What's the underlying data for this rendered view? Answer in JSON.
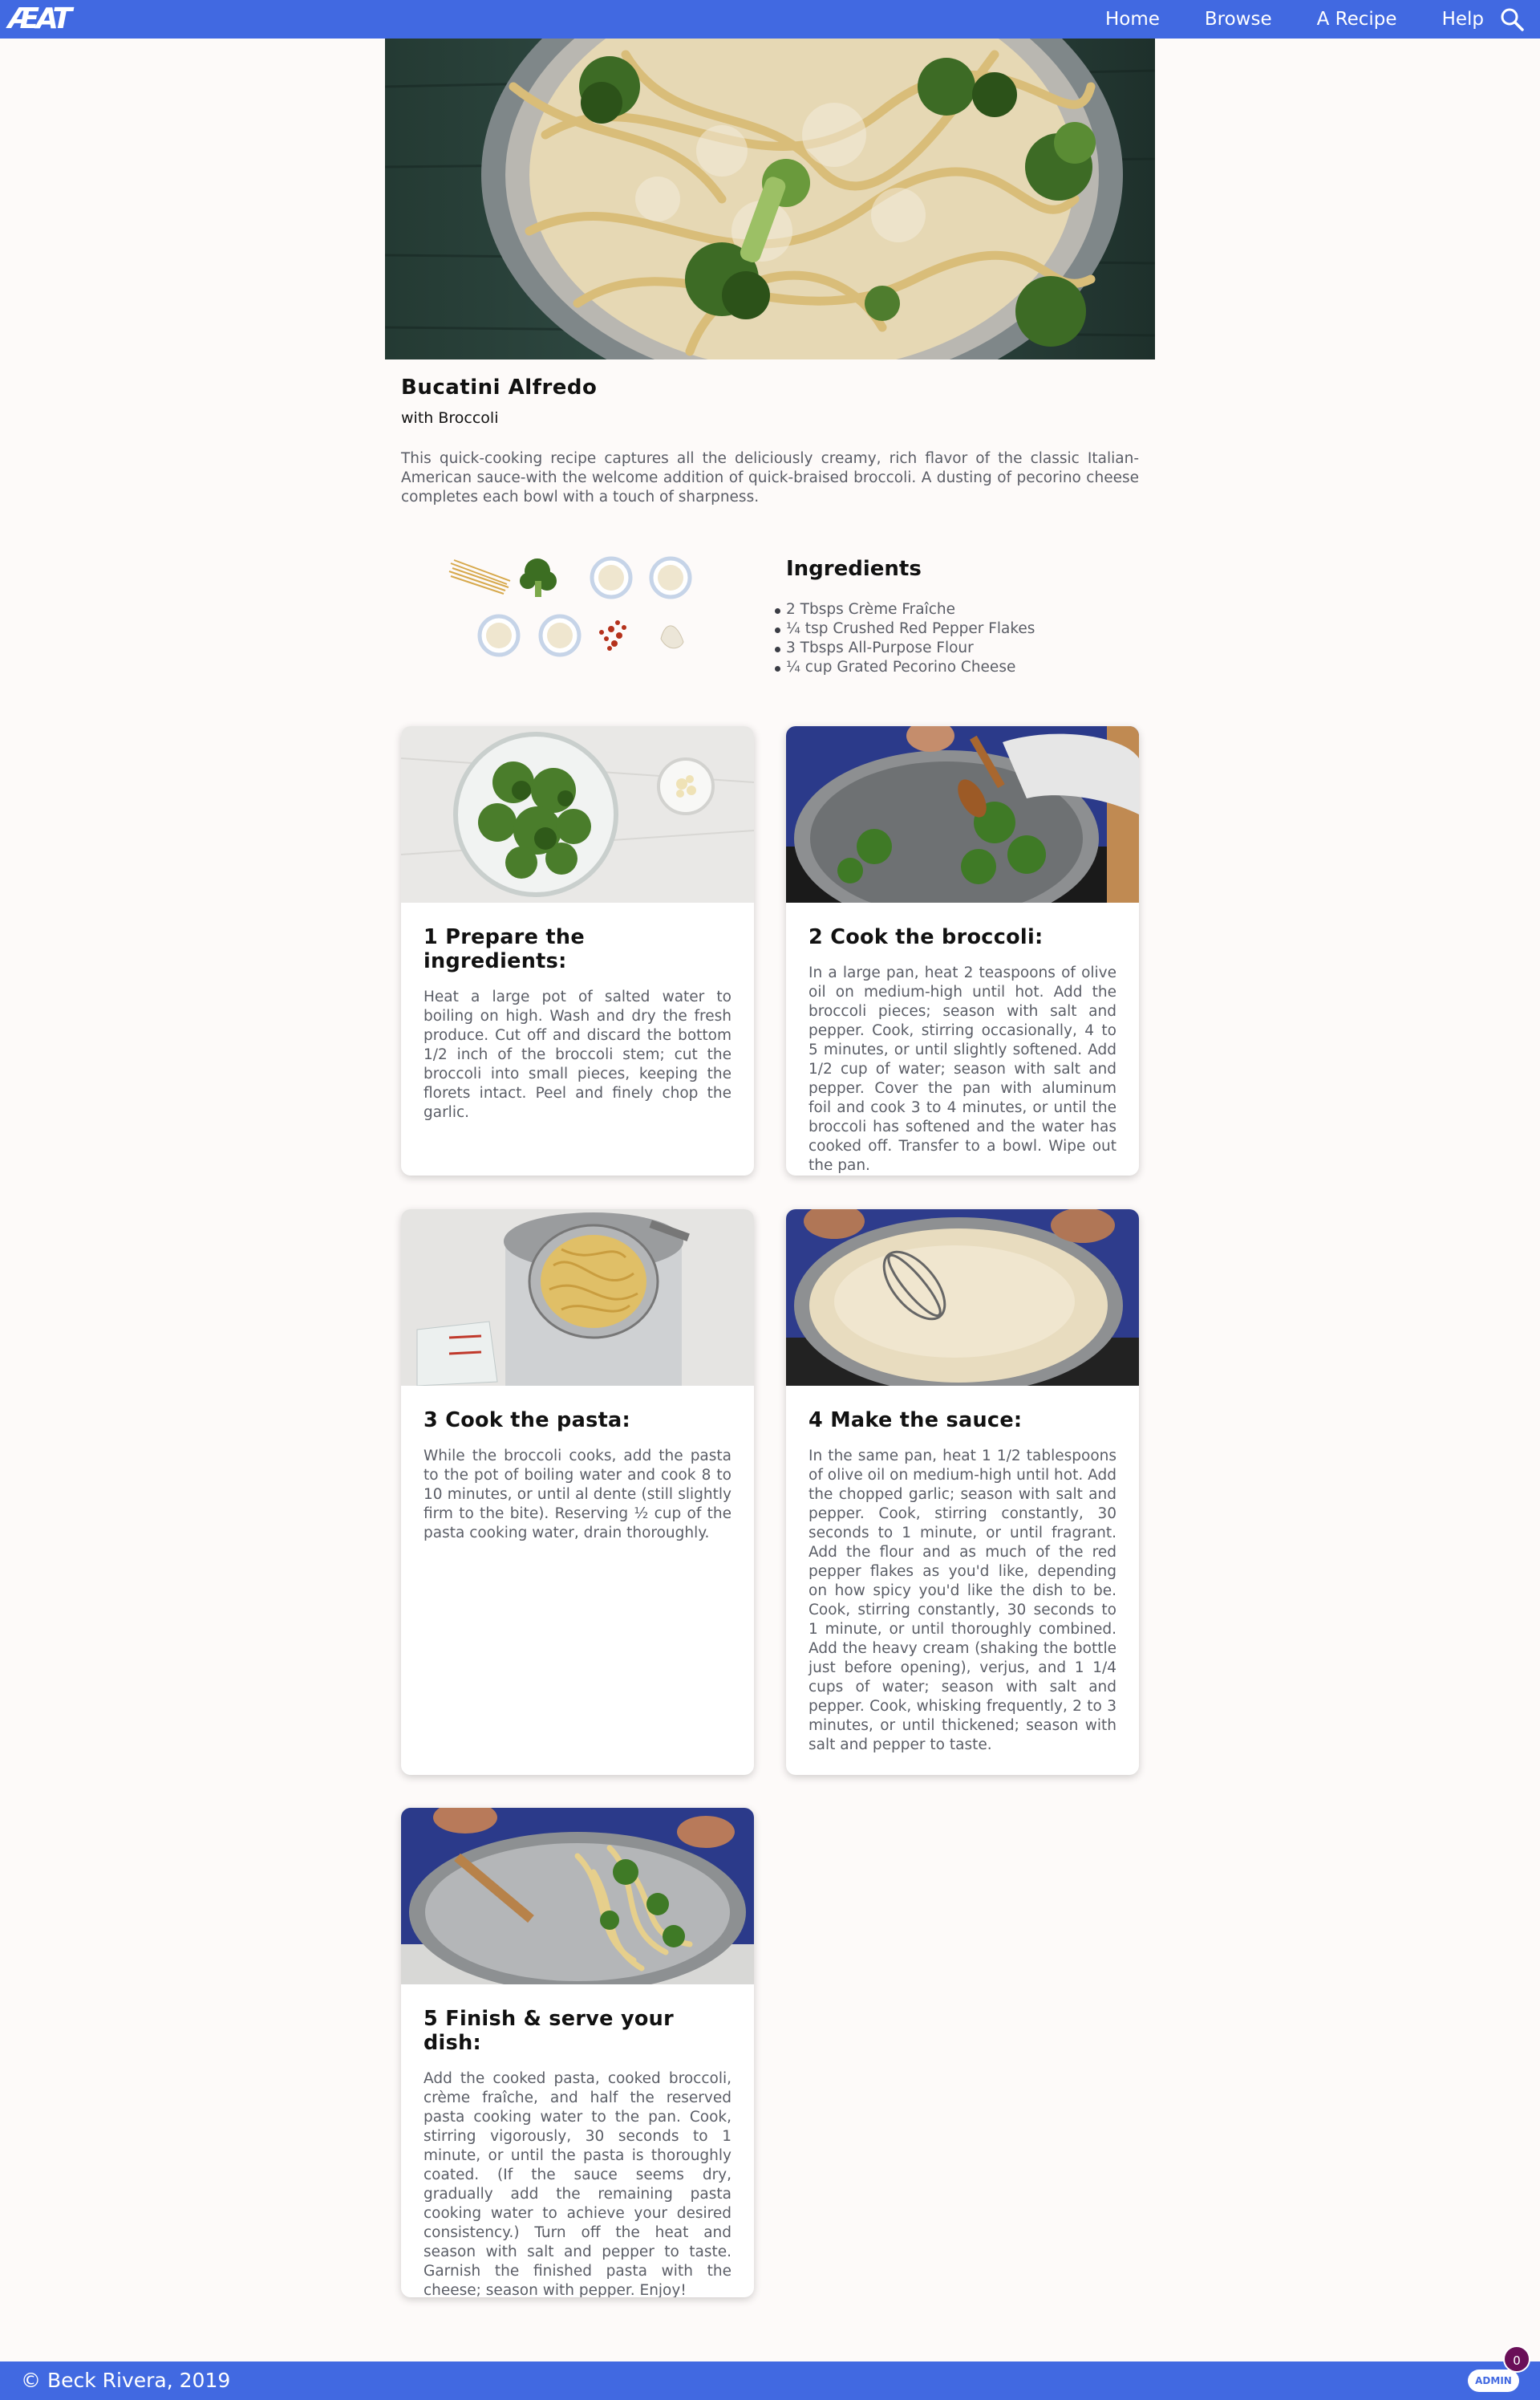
{
  "nav": {
    "logo_text": "ÆAT",
    "links": [
      "Home",
      "Browse",
      "A Recipe",
      "Help"
    ],
    "search_icon": "search-icon"
  },
  "recipe": {
    "title": "Bucatini Alfredo",
    "subtitle": "with Broccoli",
    "description": "This quick-cooking recipe captures all the deliciously creamy, rich flavor of the classic Italian-American sauce-with the welcome addition of quick-braised broccoli. A dusting of pecorino cheese completes each bowl with a touch of sharpness."
  },
  "ingredients": {
    "heading": "Ingredients",
    "items": [
      "2 Tbsps Crème Fraîche",
      "¼ tsp Crushed Red Pepper Flakes",
      "3 Tbsps All-Purpose Flour",
      "¼ cup Grated Pecorino Cheese"
    ]
  },
  "steps": [
    {
      "title": "1 Prepare the ingredients:",
      "text": "Heat a large pot of salted water to boiling on high. Wash and dry the fresh produce. Cut off and discard the bottom 1/2 inch of the broccoli stem; cut the broccoli into small pieces, keeping the florets intact. Peel and finely chop the garlic."
    },
    {
      "title": "2 Cook the broccoli:",
      "text": "In a large pan, heat 2 teaspoons of olive oil on medium-high until hot. Add the broccoli pieces; season with salt and pepper. Cook, stirring occasionally, 4 to 5 minutes, or until slightly softened. Add 1/2 cup of water; season with salt and pepper. Cover the pan with aluminum foil and cook 3 to 4 minutes, or until the broccoli has softened and the water has cooked off. Transfer to a bowl. Wipe out the pan."
    },
    {
      "title": "3 Cook the pasta:",
      "text": "While the broccoli cooks, add the pasta to the pot of boiling water and cook 8 to 10 minutes, or until al dente (still slightly firm to the bite). Reserving ½ cup of the pasta cooking water, drain thoroughly."
    },
    {
      "title": "4 Make the sauce:",
      "text": "In the same pan, heat 1 1/2 tablespoons of olive oil on medium-high until hot. Add the chopped garlic; season with salt and pepper. Cook, stirring constantly, 30 seconds to 1 minute, or until fragrant. Add the flour and as much of the red pepper flakes as you'd like, depending on how spicy you'd like the dish to be. Cook, stirring constantly, 30 seconds to 1 minute, or until thoroughly combined. Add the heavy cream (shaking the bottle just before opening), verjus, and 1 1/4 cups of water; season with salt and pepper. Cook, whisking frequently, 2 to 3 minutes, or until thickened; season with salt and pepper to taste."
    },
    {
      "title": "5 Finish & serve your dish:",
      "text": "Add the cooked pasta, cooked broccoli, crème fraîche, and half the reserved pasta cooking water to the pan. Cook, stirring vigorously, 30 seconds to 1 minute, or until the pasta is thoroughly coated. (If the sauce seems dry, gradually add the remaining pasta cooking water to achieve your desired consistency.) Turn off the heat and season with salt and pepper to taste. Garnish the finished pasta with the cheese; season with pepper. Enjoy!"
    }
  ],
  "footer": {
    "copyright": "© Beck Rivera, 2019",
    "admin_label": "ADMIN",
    "admin_count": "0"
  },
  "colors": {
    "brand_blue": "#4169e1",
    "badge_purple": "#6a0f58",
    "page_bg": "#fdfaf9"
  }
}
